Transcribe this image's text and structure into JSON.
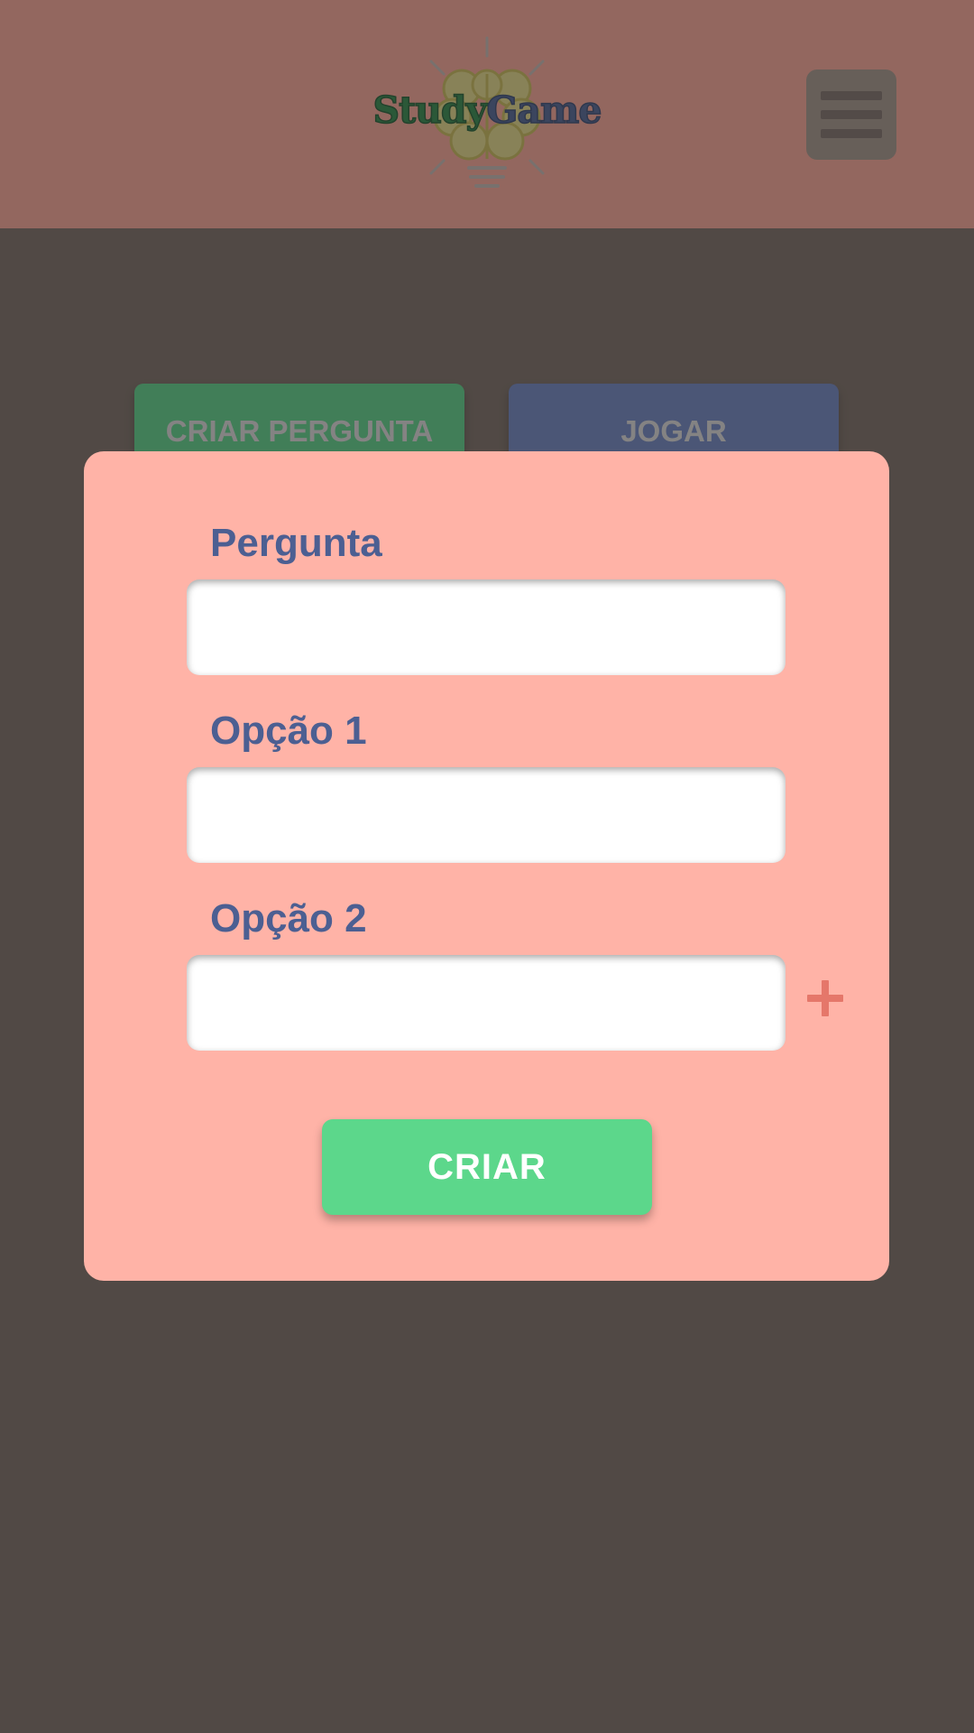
{
  "header": {
    "logo": {
      "word1": "Study",
      "word2": "Game"
    },
    "menu_icon": "hamburger-icon"
  },
  "tabs": {
    "create_label": "CRIAR PERGUNTA",
    "play_label": "JOGAR"
  },
  "modal": {
    "fields": [
      {
        "label": "Pergunta",
        "value": ""
      },
      {
        "label": "Opção 1",
        "value": ""
      },
      {
        "label": "Opção 2",
        "value": ""
      }
    ],
    "add_option_icon": "plus-icon",
    "submit_label": "CRIAR"
  },
  "colors": {
    "page_background": "#7a6d64",
    "header_background": "#ffa899",
    "modal_background": "#ffb3a7",
    "label_text": "#4c5f92",
    "primary_green": "#5cd78b",
    "play_blue": "#6f87c6",
    "accent_plus": "#e5776a"
  }
}
